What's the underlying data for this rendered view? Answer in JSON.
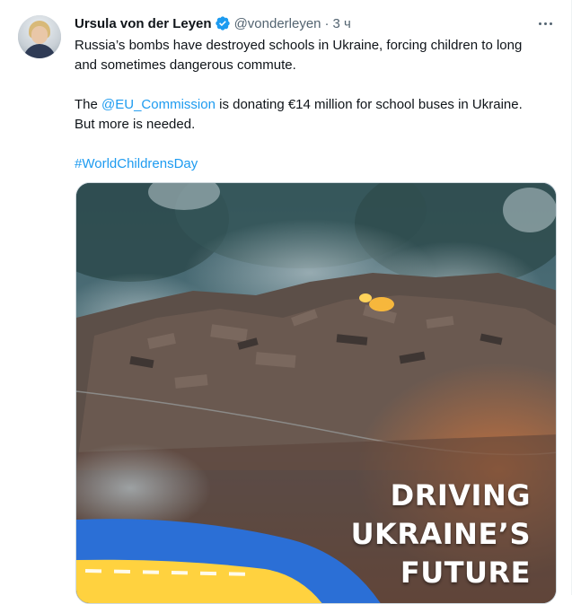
{
  "tweet": {
    "author_name": "Ursula von der Leyen",
    "handle": "@vonderleyen",
    "separator": "·",
    "time": "3 ч",
    "verified_icon": "verified-badge-icon",
    "more_icon": "more-horizontal-icon",
    "line1": "Russia’s bombs have destroyed schools in Ukraine, forcing children to long",
    "line2": "and sometimes dangerous commute.",
    "para2_prefix": "The ",
    "mention": "@EU_Commission",
    "para2_suffix": " is donating €14 million for school buses in Ukraine.",
    "para2_line2": "But more is needed.",
    "hashtag": "#WorldChildrensDay",
    "media": {
      "overlay_line1": "DRIVING",
      "overlay_line2": "UKRAINE’S",
      "overlay_line3": "FUTURE"
    }
  },
  "colors": {
    "link": "#1d9bf0",
    "verified": "#1d9bf0",
    "text": "#0f1419",
    "secondary": "#536471",
    "ukraine_blue": "#2b6fd6",
    "ukraine_yellow": "#ffd23f"
  }
}
